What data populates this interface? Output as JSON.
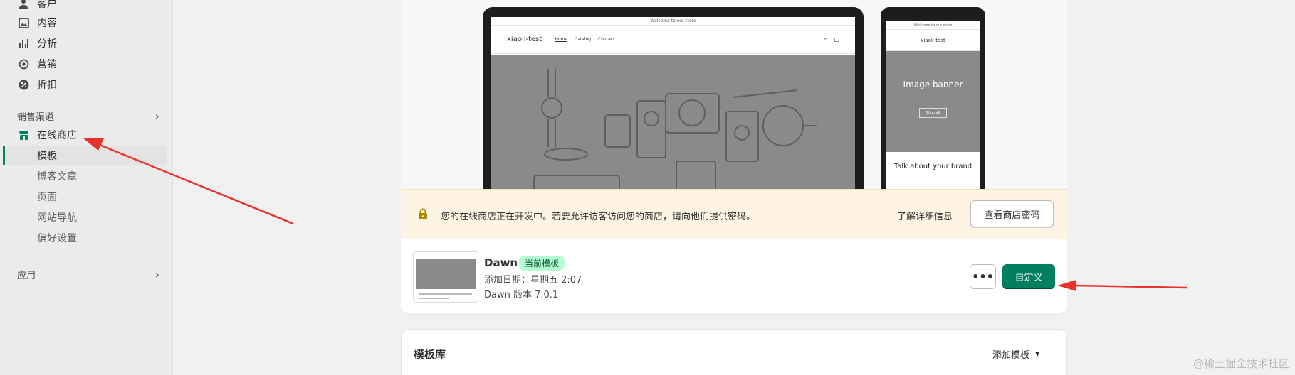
{
  "sidebar": {
    "top_items": [
      {
        "label": "客户",
        "icon": "person-icon"
      },
      {
        "label": "内容",
        "icon": "content-icon"
      },
      {
        "label": "分析",
        "icon": "analytics-icon"
      },
      {
        "label": "营销",
        "icon": "marketing-icon"
      },
      {
        "label": "折扣",
        "icon": "discount-icon"
      }
    ],
    "sales_channels_label": "销售渠道",
    "online_store_label": "在线商店",
    "sub_items": [
      "模板",
      "博客文章",
      "页面",
      "网站导航",
      "偏好设置"
    ],
    "apps_label": "应用"
  },
  "preview": {
    "announcement": "Welcome to our store",
    "store_name": "xiaoli-test",
    "nav_links": [
      "Home",
      "Catalog",
      "Contact"
    ],
    "mobile_announcement": "Welcome to our store",
    "mobile_hero_title": "Image banner",
    "mobile_hero_button": "Shop all",
    "mobile_section_title": "Talk about your brand"
  },
  "banner": {
    "message": "您的在线商店正在开发中。若要允许访客访问您的商店，请向他们提供密码。",
    "learn_more": "了解详细信息",
    "password_button": "查看商店密码"
  },
  "current_theme": {
    "name": "Dawn",
    "badge": "当前模板",
    "added": "添加日期：星期五 2:07",
    "version": "Dawn 版本 7.0.1",
    "more_label": "•••",
    "customize_label": "自定义"
  },
  "library": {
    "title": "模板库",
    "add_theme": "添加模板"
  },
  "watermark": "@稀土掘金技术社区",
  "colors": {
    "accent": "#008060",
    "badge_bg": "#b4fed2",
    "banner_bg": "#fff4e4",
    "arrow": "#e8322b"
  }
}
